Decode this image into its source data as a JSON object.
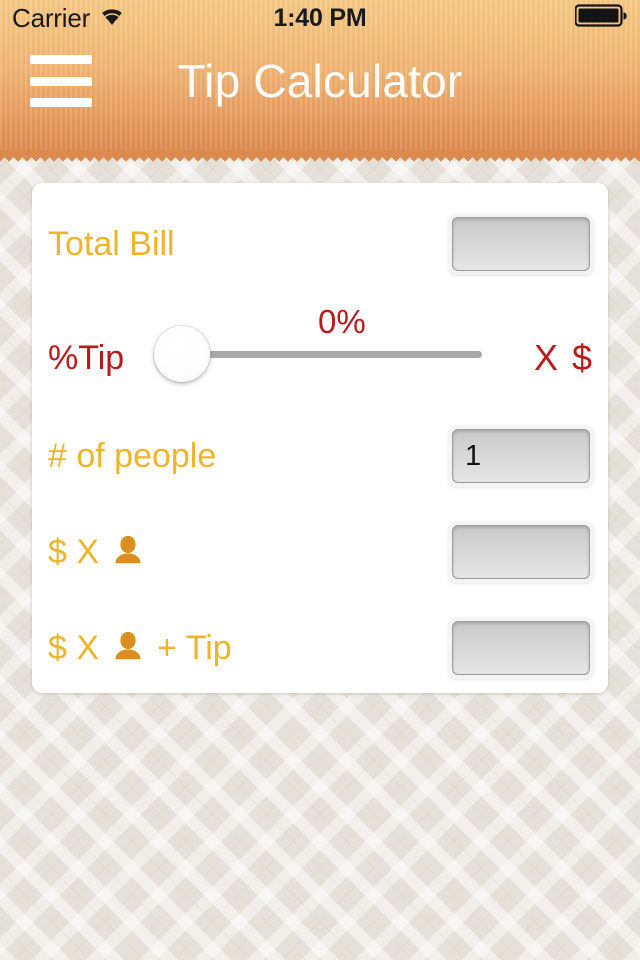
{
  "status_bar": {
    "carrier": "Carrier",
    "wifi_icon": "wifi-icon",
    "time": "1:40 PM",
    "battery_icon": "battery-full-icon"
  },
  "nav": {
    "menu_icon": "hamburger-menu-icon",
    "title": "Tip Calculator"
  },
  "form": {
    "total_bill": {
      "label": "Total Bill",
      "value": "",
      "placeholder": ""
    },
    "tip": {
      "label": "%Tip",
      "percent_value": "0%",
      "slider_value": 0,
      "slider_min": 0,
      "slider_max": 100,
      "right_label": "X $"
    },
    "people": {
      "label": "# of people",
      "value": "1",
      "placeholder": ""
    },
    "per_person": {
      "prefix": "$ X",
      "icon": "person-icon",
      "suffix": "",
      "value": "",
      "placeholder": ""
    },
    "per_person_with_tip": {
      "prefix": "$ X",
      "icon": "person-icon",
      "suffix": "+ Tip",
      "value": "",
      "placeholder": ""
    }
  },
  "colors": {
    "accent_amber": "#efb42a",
    "accent_orange": "#db901e",
    "accent_red": "#b81b1b",
    "header_top": "#f6c885",
    "header_bottom": "#dd8b4e",
    "page_bg": "#e3ded5",
    "card_bg": "#ffffff"
  }
}
